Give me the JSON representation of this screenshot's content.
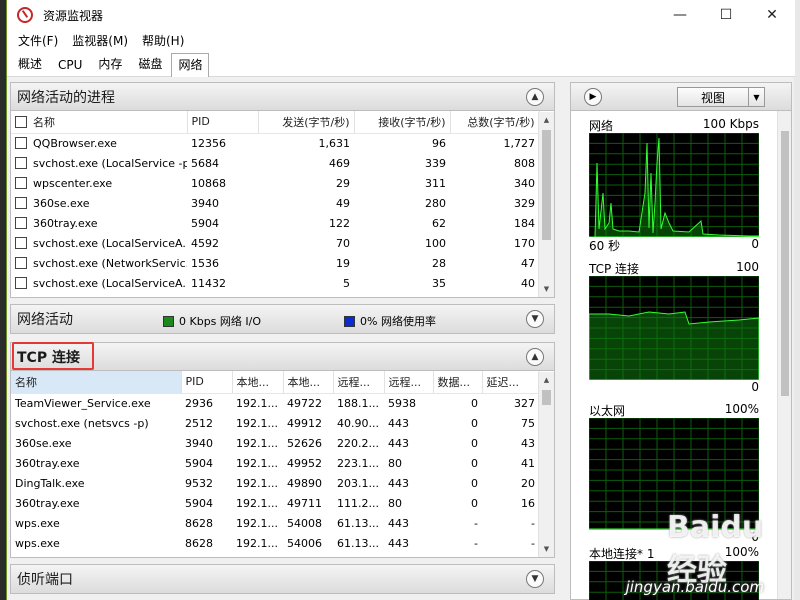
{
  "window": {
    "title": "资源监视器",
    "min": "—",
    "max": "☐",
    "close": "✕"
  },
  "menu": [
    "文件(F)",
    "监视器(M)",
    "帮助(H)"
  ],
  "tabs": [
    "概述",
    "CPU",
    "内存",
    "磁盘",
    "网络"
  ],
  "processes": {
    "title": "网络活动的进程",
    "columns": [
      "名称",
      "PID",
      "发送(字节/秒)",
      "接收(字节/秒)",
      "总数(字节/秒)"
    ],
    "rows": [
      [
        "QQBrowser.exe",
        "12356",
        "1,631",
        "96",
        "1,727"
      ],
      [
        "svchost.exe (LocalService -p)",
        "5684",
        "469",
        "339",
        "808"
      ],
      [
        "wpscenter.exe",
        "10868",
        "29",
        "311",
        "340"
      ],
      [
        "360se.exe",
        "3940",
        "49",
        "280",
        "329"
      ],
      [
        "360tray.exe",
        "5904",
        "122",
        "62",
        "184"
      ],
      [
        "svchost.exe (LocalServiceA...",
        "4592",
        "70",
        "100",
        "170"
      ],
      [
        "svchost.exe (NetworkServic...",
        "1536",
        "19",
        "28",
        "47"
      ],
      [
        "svchost.exe (LocalServiceA...",
        "11432",
        "5",
        "35",
        "40"
      ]
    ]
  },
  "network_activity": {
    "title": "网络活动",
    "io_label": "0 Kbps 网络 I/O",
    "usage_label": "0% 网络使用率",
    "io_color": "#1b8a1b",
    "usage_color": "#0a2bd6"
  },
  "tcp": {
    "title": "TCP 连接",
    "columns": [
      "名称",
      "PID",
      "本地...",
      "本地...",
      "远程...",
      "远程...",
      "数据...",
      "延迟..."
    ],
    "rows": [
      [
        "TeamViewer_Service.exe",
        "2936",
        "192.1...",
        "49722",
        "188.1...",
        "5938",
        "0",
        "327"
      ],
      [
        "svchost.exe (netsvcs -p)",
        "2512",
        "192.1...",
        "49912",
        "40.90...",
        "443",
        "0",
        "75"
      ],
      [
        "360se.exe",
        "3940",
        "192.1...",
        "52626",
        "220.2...",
        "443",
        "0",
        "43"
      ],
      [
        "360tray.exe",
        "5904",
        "192.1...",
        "49952",
        "223.1...",
        "80",
        "0",
        "41"
      ],
      [
        "DingTalk.exe",
        "9532",
        "192.1...",
        "49890",
        "203.1...",
        "443",
        "0",
        "20"
      ],
      [
        "360tray.exe",
        "5904",
        "192.1...",
        "49711",
        "111.2...",
        "80",
        "0",
        "16"
      ],
      [
        "wps.exe",
        "8628",
        "192.1...",
        "54008",
        "61.13...",
        "443",
        "-",
        "-"
      ],
      [
        "wps.exe",
        "8628",
        "192.1...",
        "54006",
        "61.13...",
        "443",
        "-",
        "-"
      ]
    ]
  },
  "listening": {
    "title": "侦听端口"
  },
  "right": {
    "view_label": "视图",
    "graphs": [
      {
        "name": "网络",
        "max": "100 Kbps",
        "bottom_left": "60 秒",
        "bottom_right": "0"
      },
      {
        "name": "TCP 连接",
        "max": "100",
        "bottom_left": "",
        "bottom_right": "0"
      },
      {
        "name": "以太网",
        "max": "100%",
        "bottom_left": "",
        "bottom_right": "0"
      },
      {
        "name": "本地连接* 1",
        "max": "100%",
        "bottom_left": "",
        "bottom_right": ""
      }
    ]
  },
  "watermark": "jingyan.baidu.com",
  "watermark_logo": "Baidu 经验"
}
